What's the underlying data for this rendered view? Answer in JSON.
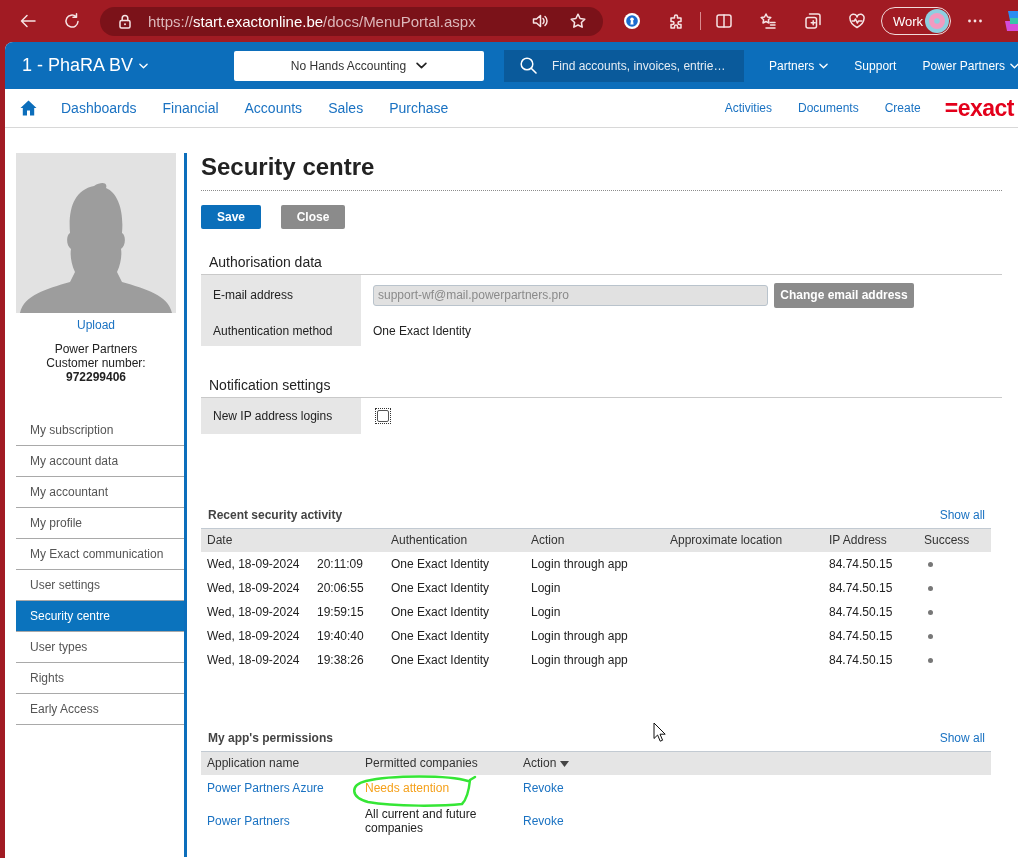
{
  "browser": {
    "url": "https://**start.exactonline.be**/docs/MenuPortal.aspx",
    "profile": "Work"
  },
  "header": {
    "company": "1 - PhaRA BV",
    "division": "No Hands Accounting",
    "search": {
      "placeholder": "Find accounts, invoices, entrie…"
    },
    "links": [
      {
        "label": "Partners",
        "dropdown": true
      },
      {
        "label": "Support",
        "dropdown": false
      },
      {
        "label": "Power Partners",
        "dropdown": true
      }
    ]
  },
  "nav": {
    "items": [
      "Dashboards",
      "Financial",
      "Accounts",
      "Sales",
      "Purchase"
    ],
    "right_items": [
      "Activities",
      "Documents",
      "Create"
    ],
    "logo": "=exact"
  },
  "sidebar": {
    "upload": "Upload",
    "account_name": "Power Partners",
    "customer_label": "Customer number:",
    "customer_number": "972299406",
    "items": [
      {
        "label": "My subscription",
        "selected": false
      },
      {
        "label": "My account data",
        "selected": false
      },
      {
        "label": "My accountant",
        "selected": false
      },
      {
        "label": "My profile",
        "selected": false
      },
      {
        "label": "My Exact communication",
        "selected": false
      },
      {
        "label": "User settings",
        "selected": false
      },
      {
        "label": "Security centre",
        "selected": true
      },
      {
        "label": "User types",
        "selected": false
      },
      {
        "label": "Rights",
        "selected": false
      },
      {
        "label": "Early Access",
        "selected": false
      }
    ]
  },
  "page": {
    "title": "Security centre",
    "buttons": [
      {
        "label": "Save",
        "kind": "primary"
      },
      {
        "label": "Close",
        "kind": "secondary"
      }
    ]
  },
  "authorisation": {
    "title": "Authorisation data",
    "email": {
      "label": "E-mail address",
      "value": "support-wf@mail.powerpartners.pro",
      "disabled": true
    },
    "change_button": "Change email address",
    "method": {
      "label": "Authentication method",
      "value": "One Exact Identity"
    }
  },
  "notifications": {
    "title": "Notification settings",
    "rows": [
      {
        "label": "New IP address logins",
        "checked": false
      }
    ]
  },
  "security_activity": {
    "title": "Recent security activity",
    "show_all": "Show all",
    "columns": [
      "Date",
      "Authentication",
      "Action",
      "Approximate location",
      "IP Address",
      "Success"
    ],
    "rows": [
      {
        "date": "Wed, 18-09-2024",
        "time": "20:11:09",
        "authentication": "One Exact Identity",
        "action": "Login through app",
        "ip": "84.74.50.15",
        "success": true
      },
      {
        "date": "Wed, 18-09-2024",
        "time": "20:06:55",
        "authentication": "One Exact Identity",
        "action": "Login",
        "ip": "84.74.50.15",
        "success": true
      },
      {
        "date": "Wed, 18-09-2024",
        "time": "19:59:15",
        "authentication": "One Exact Identity",
        "action": "Login",
        "ip": "84.74.50.15",
        "success": true
      },
      {
        "date": "Wed, 18-09-2024",
        "time": "19:40:40",
        "authentication": "One Exact Identity",
        "action": "Login through app",
        "ip": "84.74.50.15",
        "success": true
      },
      {
        "date": "Wed, 18-09-2024",
        "time": "19:38:26",
        "authentication": "One Exact Identity",
        "action": "Login through app",
        "ip": "84.74.50.15",
        "success": true
      }
    ]
  },
  "permissions": {
    "title": "My app's permissions",
    "show_all": "Show all",
    "columns": [
      {
        "label": "Application name",
        "sorted": false
      },
      {
        "label": "Permitted companies",
        "sorted": false
      },
      {
        "label": "Action",
        "sorted": true
      }
    ],
    "rows": [
      {
        "application": "Power Partners Azure",
        "companies": "Needs attention",
        "attention": true,
        "circled": true,
        "action": "Revoke"
      },
      {
        "application": "Power Partners",
        "companies": "All current and future companies",
        "attention": false,
        "circled": false,
        "action": "Revoke"
      }
    ]
  }
}
